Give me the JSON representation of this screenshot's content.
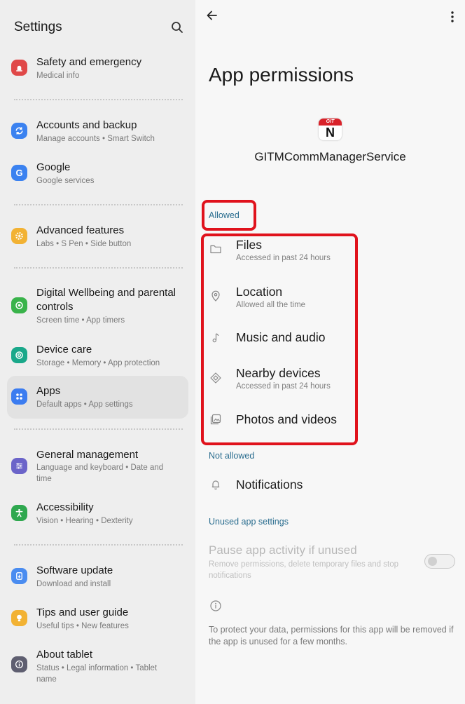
{
  "left": {
    "title": "Settings",
    "search_icon": "search-icon",
    "items": [
      {
        "title": "Safety and emergency",
        "subtitle": "Medical info",
        "icon": "siren-icon",
        "color": "#e04848"
      },
      {
        "title": "Accounts and backup",
        "subtitle": "Manage accounts  •  Smart Switch",
        "icon": "sync-icon",
        "color": "#3b82f0"
      },
      {
        "title": "Google",
        "subtitle": "Google services",
        "icon": "google-icon",
        "color": "#3b82f0"
      },
      {
        "title": "Advanced features",
        "subtitle": "Labs  •  S Pen  •  Side button",
        "icon": "gear-plus-icon",
        "color": "#f2b233"
      },
      {
        "title": "Digital Wellbeing and parental controls",
        "subtitle": "Screen time  •  App timers",
        "icon": "wellbeing-icon",
        "color": "#39b34a"
      },
      {
        "title": "Device care",
        "subtitle": "Storage  •  Memory  •  App protection",
        "icon": "device-care-icon",
        "color": "#1aa88a"
      },
      {
        "title": "Apps",
        "subtitle": "Default apps  •  App settings",
        "icon": "apps-grid-icon",
        "color": "#3b7cf0",
        "selected": true
      },
      {
        "title": "General management",
        "subtitle": "Language and keyboard  •  Date and time",
        "icon": "sliders-icon",
        "color": "#6b64c9"
      },
      {
        "title": "Accessibility",
        "subtitle": "Vision  •  Hearing  •  Dexterity",
        "icon": "accessibility-icon",
        "color": "#2fa84f"
      },
      {
        "title": "Software update",
        "subtitle": "Download and install",
        "icon": "update-icon",
        "color": "#4a8cf0"
      },
      {
        "title": "Tips and user guide",
        "subtitle": "Useful tips  •  New features",
        "icon": "lightbulb-icon",
        "color": "#f2b233"
      },
      {
        "title": "About tablet",
        "subtitle": "Status  •  Legal information  •  Tablet name",
        "icon": "info-icon",
        "color": "#5e5e70"
      }
    ]
  },
  "right": {
    "page_title": "App permissions",
    "app_icon_band": "GIT",
    "app_icon_letter": "N",
    "app_name": "GITMCommManagerService",
    "sections": {
      "allowed": "Allowed",
      "not_allowed": "Not allowed",
      "unused": "Unused app settings"
    },
    "allowed_permissions": [
      {
        "title": "Files",
        "subtitle": "Accessed in past 24 hours",
        "icon": "folder-icon"
      },
      {
        "title": "Location",
        "subtitle": "Allowed all the time",
        "icon": "location-pin-icon"
      },
      {
        "title": "Music and audio",
        "subtitle": "",
        "icon": "music-note-icon"
      },
      {
        "title": "Nearby devices",
        "subtitle": "Accessed in past 24 hours",
        "icon": "nearby-devices-icon"
      },
      {
        "title": "Photos and videos",
        "subtitle": "",
        "icon": "photos-icon"
      }
    ],
    "not_allowed_permissions": [
      {
        "title": "Notifications",
        "icon": "bell-icon"
      }
    ],
    "pause": {
      "title": "Pause app activity if unused",
      "subtitle": "Remove permissions, delete temporary files and stop notifications",
      "enabled": false
    },
    "info_text": "To protect your data, permissions for this app will be removed if the app is unused for a few months."
  },
  "colors": {
    "highlight": "#e0121c",
    "section_label": "#2a6d8f"
  }
}
